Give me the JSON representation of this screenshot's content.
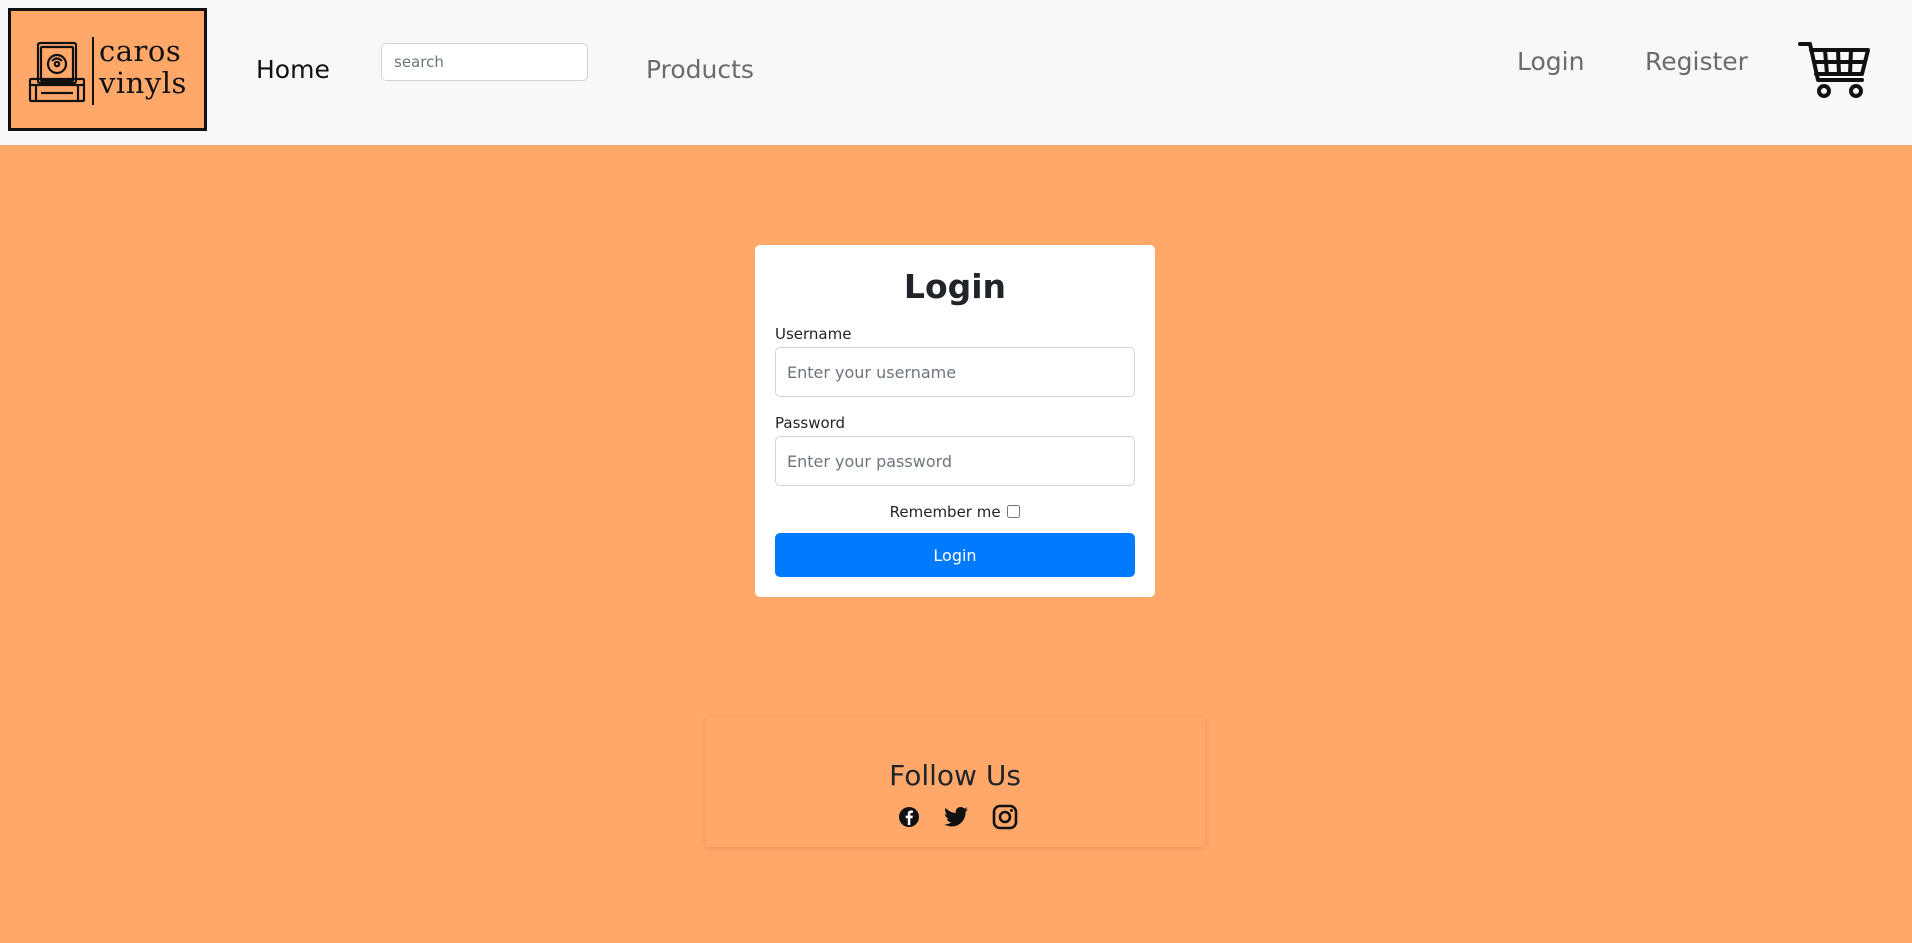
{
  "brand": {
    "logo_line1": "caros",
    "logo_line2": "vinyls",
    "logo_icon": "vinyl-box-icon"
  },
  "nav": {
    "home": "Home",
    "search_placeholder": "search",
    "products": "Products",
    "login": "Login",
    "register": "Register",
    "cart_icon": "cart-icon"
  },
  "login_form": {
    "title": "Login",
    "username_label": "Username",
    "username_placeholder": "Enter your username",
    "password_label": "Password",
    "password_placeholder": "Enter your password",
    "remember_label": "Remember me",
    "remember_checked": false,
    "submit_label": "Login"
  },
  "footer": {
    "follow_title": "Follow Us",
    "social_icons": [
      "facebook-icon",
      "twitter-icon",
      "instagram-icon"
    ]
  },
  "colors": {
    "background": "#ffa86a",
    "navbar": "#f7f8fa",
    "primary_button": "#007bff"
  }
}
